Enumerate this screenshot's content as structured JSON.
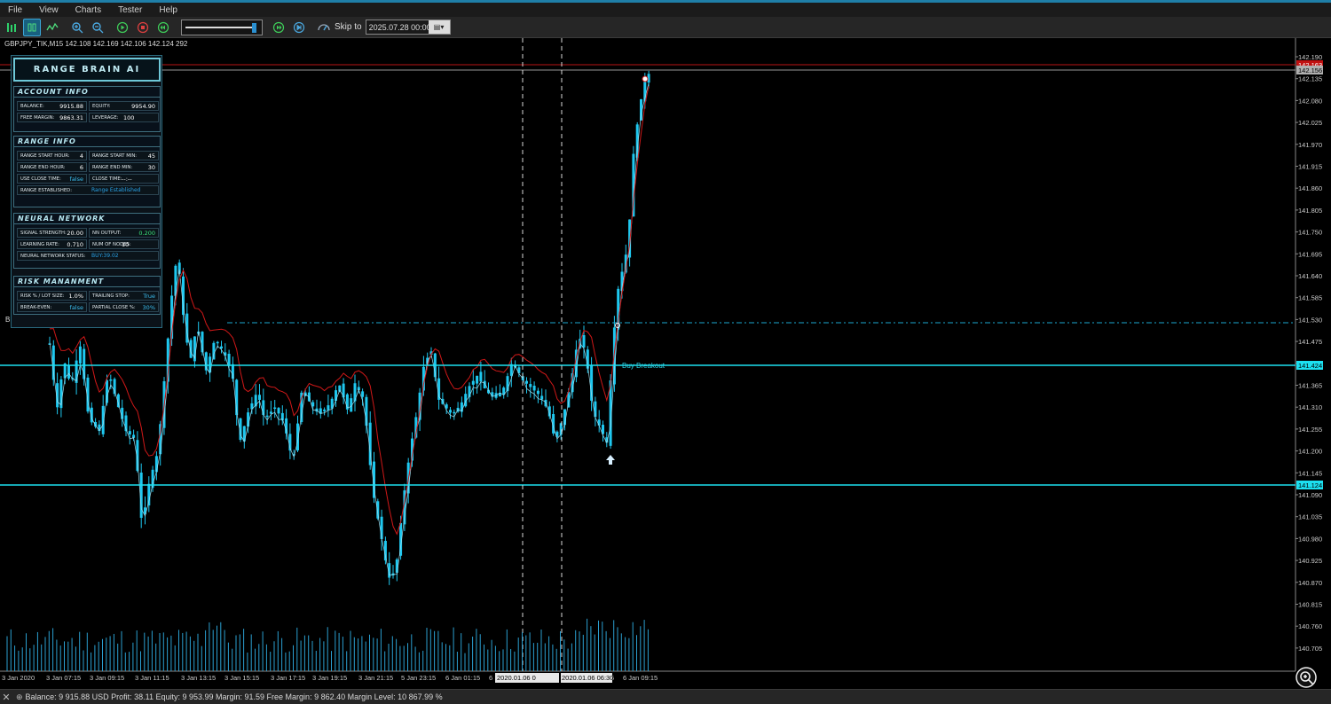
{
  "menu": [
    "File",
    "View",
    "Charts",
    "Tester",
    "Help"
  ],
  "toolbar": {
    "skip_label": "Skip to",
    "skip_date": "2025.07.28 00:00",
    "buttons": [
      "candles-icon",
      "bars-icon",
      "line-icon",
      "zoom-in-icon",
      "zoom-out-icon",
      "play-icon",
      "stop-icon",
      "rewind-icon",
      "forward-icon",
      "step-icon",
      "skip-icon"
    ]
  },
  "chart": {
    "symbol_line": "GBPJPY_TIK,M15  142.108 142.169 142.106 142.124  292",
    "signal_label": "Buy Breakout",
    "b_marker": "B",
    "price_labels": [
      "142.190",
      "142.135",
      "142.080",
      "142.025",
      "141.970",
      "141.915",
      "141.860",
      "141.805",
      "141.750",
      "141.695",
      "141.640",
      "141.585",
      "141.530",
      "141.475",
      "141.420",
      "141.365",
      "141.310",
      "141.255",
      "141.200",
      "141.145",
      "141.090",
      "141.035",
      "140.980",
      "140.925",
      "140.870",
      "140.815",
      "140.760",
      "140.705"
    ],
    "price_tags": {
      "red": "142.163",
      "gray": "142.156",
      "cyan_top": "141.424",
      "cyan_bottom": "141.124"
    },
    "time_labels": [
      "3 Jan 2020",
      "3 Jan 07:15",
      "3 Jan 09:15",
      "3 Jan 11:15",
      "3 Jan 13:15",
      "3 Jan 15:15",
      "3 Jan 17:15",
      "3 Jan 19:15",
      "3 Jan 21:15",
      "5 Jan 23:15",
      "6 Jan 01:15",
      "6",
      "6 Jan 07:15",
      "6 Jan 09:15"
    ],
    "time_highlight": [
      "2020.01.06 0",
      "2020.01.06 06:30"
    ],
    "colors": {
      "candle": "#1ec8f0",
      "ma": "#d01818",
      "level": "#1ce0f0"
    }
  },
  "panel": {
    "title": "RANGE BRAIN AI",
    "account": {
      "header": "ACCOUNT INFO",
      "balance_label": "BALANCE:",
      "balance": "9915.88",
      "equity_label": "EQUITY:",
      "equity": "9954.90",
      "free_margin_label": "FREE MARGIN:",
      "free_margin": "9863.31",
      "leverage_label": "LEVERAGE:",
      "leverage": "100"
    },
    "range": {
      "header": "RANGE INFO",
      "start_hour_label": "RANGE START HOUR:",
      "start_hour": "4",
      "start_min_label": "RANGE START MIN:",
      "start_min": "45",
      "end_hour_label": "RANGE END HOUR:",
      "end_hour": "6",
      "end_min_label": "RANGE END MIN:",
      "end_min": "30",
      "use_close_label": "USE CLOSE TIME:",
      "use_close": "false",
      "close_time_label": "CLOSE TIME:",
      "close_time": "--:--",
      "established_label": "RANGE ESTABLISHED:",
      "established": "Range Established"
    },
    "nn": {
      "header": "NEURAL NETWORK",
      "signal_label": "SIGNAL STRENGTH:",
      "signal": "20.00",
      "output_label": "NN OUTPUT:",
      "output": "0.200",
      "lr_label": "LEARNING RATE:",
      "lr": "0.710",
      "nodes_label": "NUM OF NODES:",
      "nodes": "10",
      "status_label": "NEURAL NETWORK STATUS:",
      "status": "BUY:39.02"
    },
    "risk": {
      "header": "RISK MANANMENT",
      "risk_label": "RISK % / LOT SIZE:",
      "risk": "1.0%",
      "trailing_label": "TRAILING STOP:",
      "trailing": "True",
      "be_label": "BREAK-EVEN:",
      "be": "false",
      "partial_label": "PARTIAL CLOSE %:",
      "partial": "30%"
    }
  },
  "status_bar": "Balance: 9 915.88 USD  Profit: 38.11  Equity: 9 953.99  Margin: 91.59  Free Margin: 9 862.40  Margin Level: 10 867.99 %"
}
